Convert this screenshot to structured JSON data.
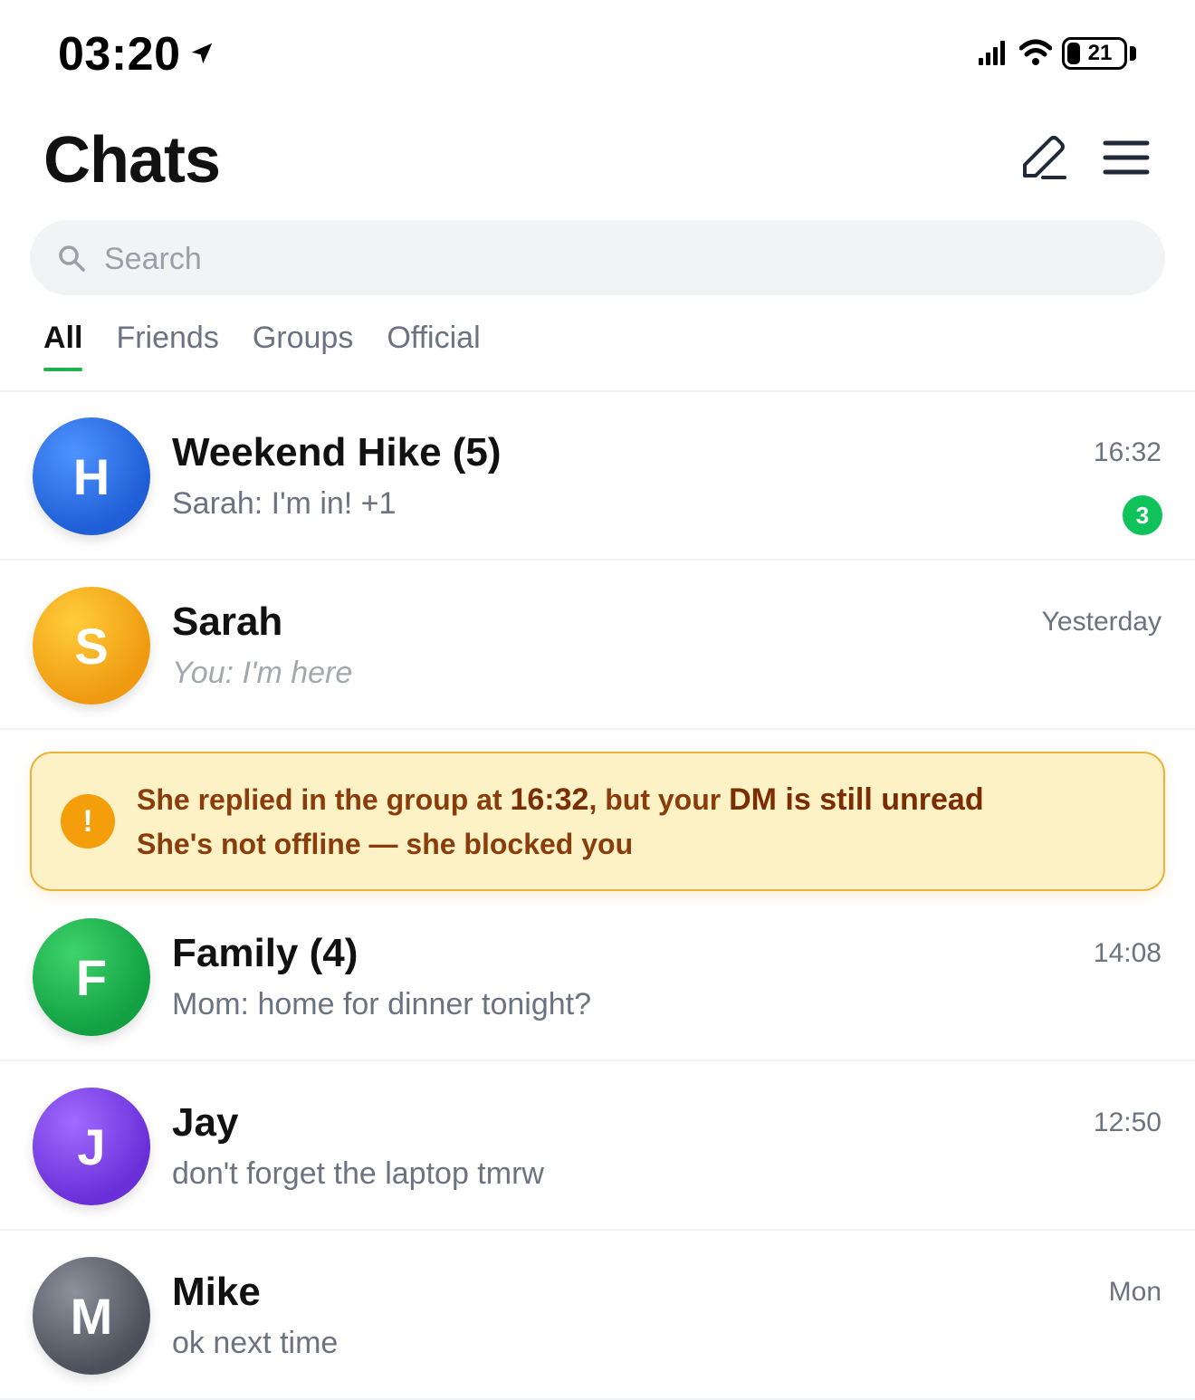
{
  "status_bar": {
    "time": "03:20",
    "location_icon": "location-arrow-icon",
    "signal_icon": "cellular-signal-icon",
    "wifi_icon": "wifi-icon",
    "battery_level": "21"
  },
  "header": {
    "title": "Chats",
    "compose_icon": "compose-pencil-icon",
    "menu_icon": "hamburger-menu-icon"
  },
  "search": {
    "placeholder": "Search",
    "value": "",
    "icon": "search-icon"
  },
  "tabs": [
    {
      "label": "All",
      "active": true
    },
    {
      "label": "Friends",
      "active": false
    },
    {
      "label": "Groups",
      "active": false
    },
    {
      "label": "Official",
      "active": false
    }
  ],
  "chats": [
    {
      "initial": "H",
      "name": "Weekend Hike (5)",
      "preview": "Sarah: I'm in! +1",
      "time": "16:32",
      "unread": "3",
      "avatar_color": "#2f6fe0"
    },
    {
      "initial": "S",
      "name": "Sarah",
      "preview": "You: I'm here",
      "time": "Yesterday",
      "avatar_color": "#f2a516"
    },
    {
      "initial": "F",
      "name": "Family (4)",
      "preview": "Mom: home for dinner tonight?",
      "time": "14:08",
      "avatar_color": "#1fae4b"
    },
    {
      "initial": "J",
      "name": "Jay",
      "preview": "don't forget the laptop tmrw",
      "time": "12:50",
      "avatar_color": "#7b3fe4"
    },
    {
      "initial": "M",
      "name": "Mike",
      "preview": "ok next time",
      "time": "Mon",
      "avatar_color": "#5f6470"
    }
  ],
  "alert": {
    "icon": "!",
    "line1_a": "She replied in the group at ",
    "line1_time": "16:32",
    "line1_b": ", but your ",
    "line1_dm": "DM is still unread",
    "line2": "She's not offline — she blocked you",
    "color_bg": "#fdf2c5",
    "color_border": "#e9b23a",
    "color_text": "#8a3c0b"
  }
}
